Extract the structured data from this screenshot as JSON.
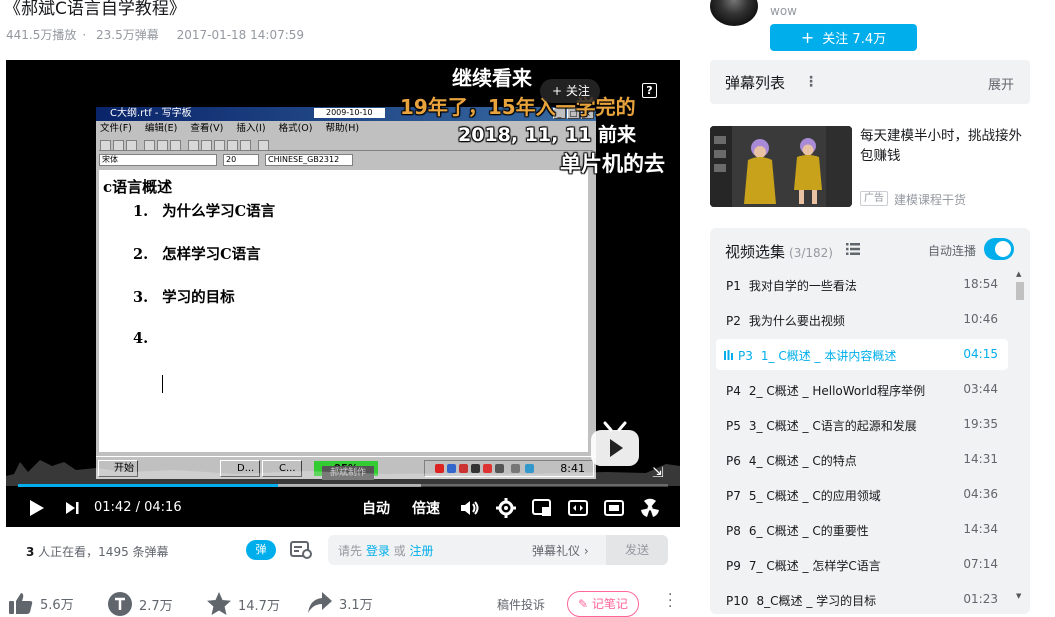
{
  "video": {
    "title": "《郝斌C语言自学教程》",
    "plays": "441.5万播放",
    "danmaku": "23.5万弹幕",
    "date": "2017-01-18 14:07:59"
  },
  "screen": {
    "window_title": "C大纲.rtf - 写字板",
    "window_date": "2009-10-10",
    "menu": [
      "文件(F)",
      "编辑(E)",
      "查看(V)",
      "插入(I)",
      "格式(O)",
      "帮助(H)"
    ],
    "font_name": "宋体",
    "font_size": "20",
    "charset": "CHINESE_GB2312",
    "doc_heading": "c语言概述",
    "doc_items": [
      {
        "num": "1.",
        "text": "为什么学习C语言"
      },
      {
        "num": "2.",
        "text": "怎样学习C语言"
      },
      {
        "num": "3.",
        "text": "学习的目标"
      },
      {
        "num": "4.",
        "text": ""
      }
    ],
    "taskbar_start": "开始",
    "taskbar_tasks": [
      "D...",
      "C..."
    ],
    "taskbar_percent": "95%",
    "taskbar_clock": "8:41",
    "tag_card": "郝斌制作"
  },
  "danmu": {
    "line1": "继续看来",
    "line2": "19年了，15年入一学完的",
    "line3": "2018, 11, 11  前来",
    "line4": "单片机的去"
  },
  "player": {
    "follow_chip": "+ 关注",
    "help": "?",
    "current_time": "01:42",
    "total_time": "04:16",
    "progress": 0.4,
    "buffered": 0.62,
    "auto_label": "自动",
    "speed_label": "倍速"
  },
  "bar": {
    "viewers_count": "3",
    "viewers_text": " 人正在看，1495 条弹幕",
    "toggle": "弹",
    "input_prefix": "请先 ",
    "login": "登录",
    "or": " 或 ",
    "register": "注册",
    "etiquette": "弹幕礼仪 ›",
    "send": "发送"
  },
  "actions": {
    "like": "5.6万",
    "coin": "2.7万",
    "favorite": "14.7万",
    "share": "3.1万",
    "report": "稿件投诉",
    "note": "记笔记"
  },
  "uploader": {
    "name": "wow",
    "follow": "关注 7.4万"
  },
  "danmu_list": {
    "title": "弹幕列表",
    "expand": "展开"
  },
  "ad": {
    "title": "每天建模半小时，挑战接外包赚钱",
    "tag": "广告",
    "subtitle": "建模课程干货"
  },
  "playlist": {
    "title": "视频选集",
    "count": "(3/182)",
    "autoplay": "自动连播",
    "autoplay_on": true,
    "episodes": [
      {
        "p": "P1",
        "title": "我对自学的一些看法",
        "dur": "18:54"
      },
      {
        "p": "P2",
        "title": "我为什么要出视频",
        "dur": "10:46"
      },
      {
        "p": "P3",
        "title": "1_ C概述 _ 本讲内容概述",
        "dur": "04:15",
        "active": true
      },
      {
        "p": "P4",
        "title": "2_ C概述 _ HelloWorld程序举例",
        "dur": "03:44"
      },
      {
        "p": "P5",
        "title": "3_ C概述 _ C语言的起源和发展",
        "dur": "19:35"
      },
      {
        "p": "P6",
        "title": "4_ C概述 _ C的特点",
        "dur": "14:31"
      },
      {
        "p": "P7",
        "title": "5_ C概述 _ C的应用领域",
        "dur": "04:36"
      },
      {
        "p": "P8",
        "title": "6_ C概述 _ C的重要性",
        "dur": "14:34"
      },
      {
        "p": "P9",
        "title": "7_ C概述 _ 怎样学C语言",
        "dur": "07:14"
      },
      {
        "p": "P10",
        "title": "8_C概述 _ 学习的目标",
        "dur": "01:23"
      }
    ]
  },
  "colors": {
    "accent": "#00aeec",
    "pink": "#ff6699",
    "muted": "#9499a0"
  }
}
